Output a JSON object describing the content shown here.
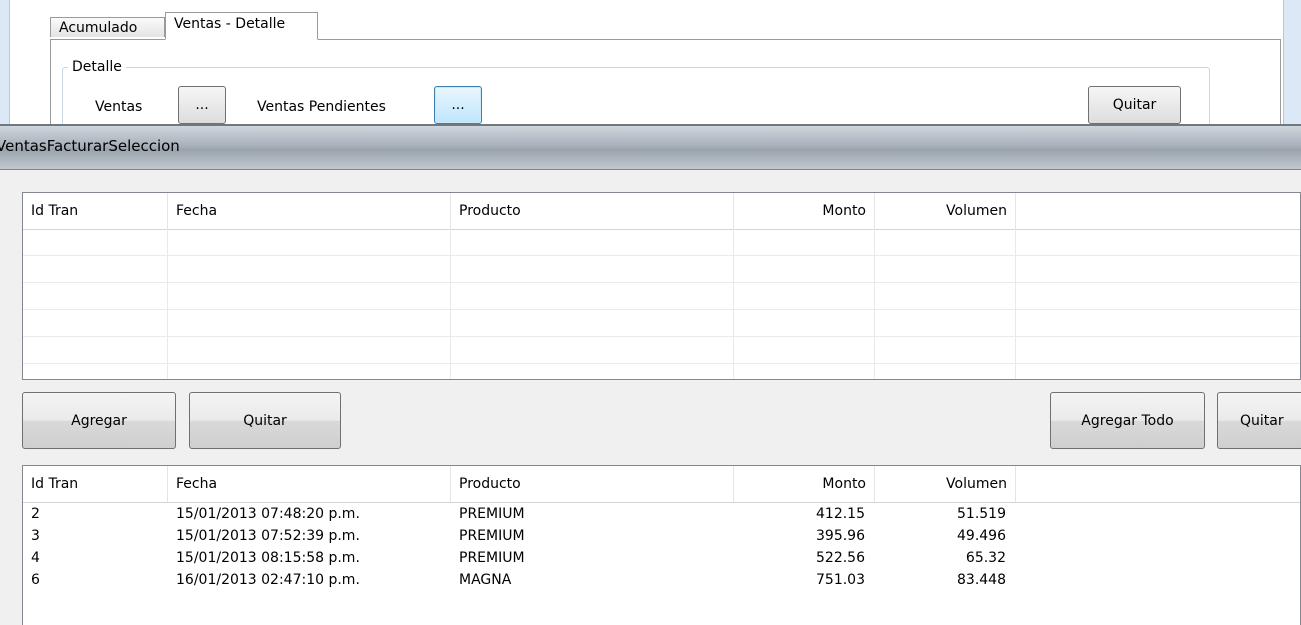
{
  "background_window": {
    "tabs": [
      {
        "label": "Acumulado",
        "selected": false
      },
      {
        "label": "Ventas - Detalle",
        "selected": true
      }
    ],
    "group_label": "Detalle",
    "ventas_label": "Ventas",
    "ventas_button": "...",
    "pendientes_label": "Ventas Pendientes",
    "pendientes_button": "...",
    "quitar_button": "Quitar"
  },
  "dialog": {
    "title": "VentasFacturarSeleccion",
    "columns": [
      "Id Tran",
      "Fecha",
      "Producto",
      "Monto",
      "Volumen"
    ],
    "buttons": {
      "agregar": "Agregar",
      "quitar": "Quitar",
      "agregar_todo": "Agregar Todo",
      "quitar_todo": "Quitar"
    },
    "pending_rows": [
      {
        "id": "2",
        "fecha": "15/01/2013 07:48:20 p.m.",
        "producto": "PREMIUM",
        "monto": "412.15",
        "volumen": "51.519"
      },
      {
        "id": "3",
        "fecha": "15/01/2013 07:52:39 p.m.",
        "producto": "PREMIUM",
        "monto": "395.96",
        "volumen": "49.496"
      },
      {
        "id": "4",
        "fecha": "15/01/2013 08:15:58 p.m.",
        "producto": "PREMIUM",
        "monto": "522.56",
        "volumen": "65.32"
      },
      {
        "id": "6",
        "fecha": "16/01/2013 02:47:10 p.m.",
        "producto": "MAGNA",
        "monto": "751.03",
        "volumen": "83.448"
      }
    ]
  }
}
